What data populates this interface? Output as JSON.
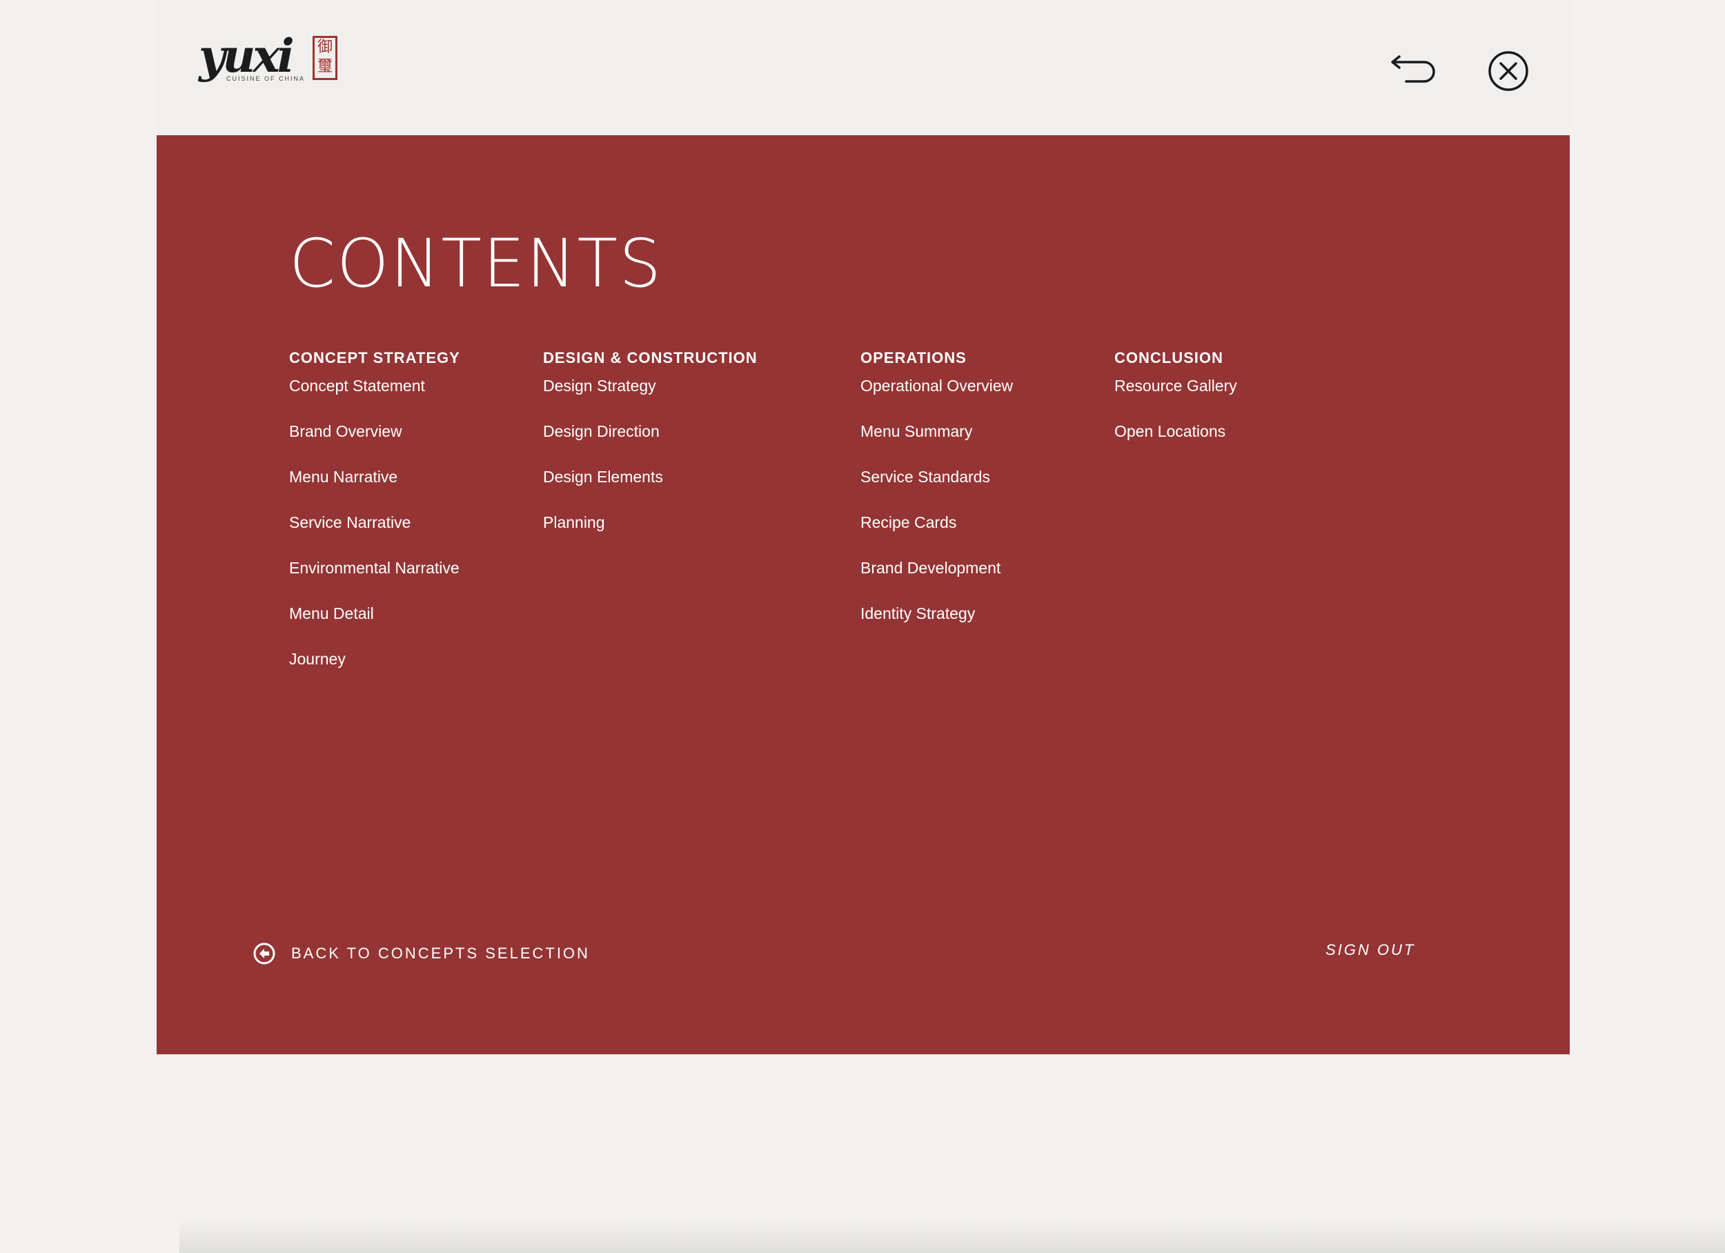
{
  "header": {
    "logo": {
      "wordmark": "yuxi",
      "tagline": "CUISINE OF CHINA",
      "seal_chars": "御璽"
    },
    "back_icon": "return-arrow-icon",
    "close_icon": "close-circle-icon"
  },
  "menu": {
    "title": "CONTENTS",
    "columns": [
      {
        "heading": "CONCEPT STRATEGY",
        "items": [
          "Concept Statement",
          "Brand Overview",
          "Menu Narrative",
          "Service Narrative",
          "Environmental Narrative",
          "Menu Detail",
          "Journey"
        ]
      },
      {
        "heading": "DESIGN & CONSTRUCTION",
        "items": [
          "Design Strategy",
          "Design Direction",
          "Design Elements",
          "Planning"
        ]
      },
      {
        "heading": "OPERATIONS",
        "items": [
          "Operational Overview",
          "Menu Summary",
          "Service Standards",
          "Recipe Cards",
          "Brand Development",
          "Identity Strategy"
        ]
      },
      {
        "heading": "CONCLUSION",
        "items": [
          "Resource Gallery",
          "Open Locations"
        ]
      }
    ]
  },
  "footer": {
    "back_label": "BACK TO CONCEPTS SELECTION",
    "back_icon": "arrow-left-circle-icon",
    "signout_label": "SIGN OUT"
  },
  "colors": {
    "panel_red": "#953434",
    "background": "#f2f1ef",
    "seal_red": "#a0332f"
  }
}
